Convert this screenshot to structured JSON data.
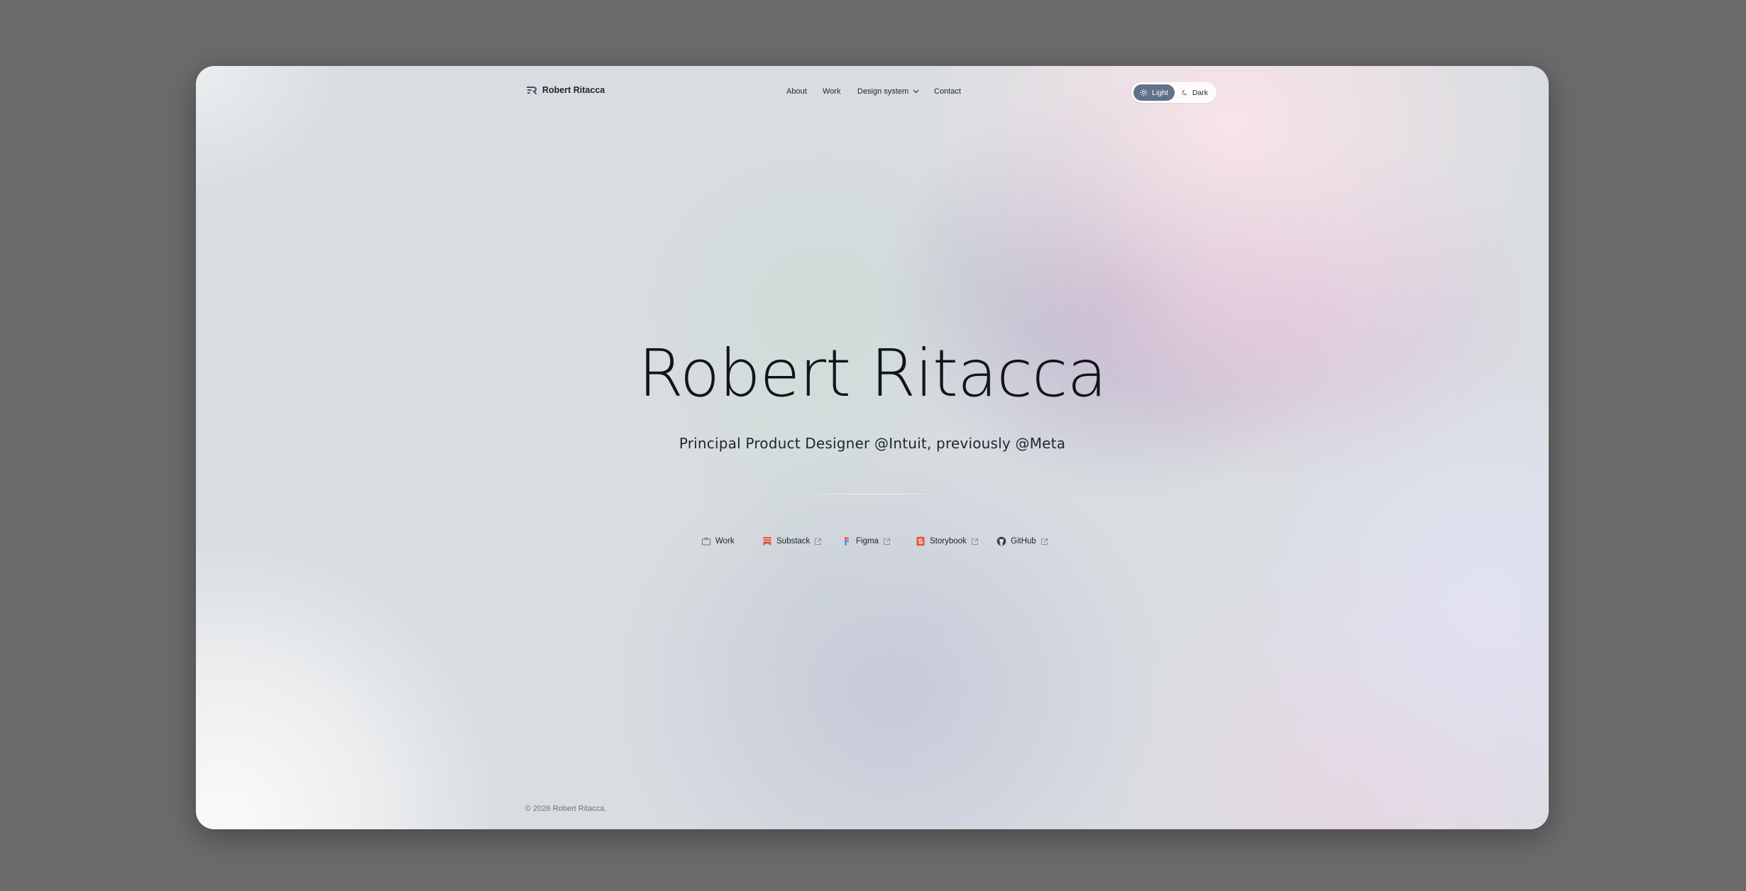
{
  "nav": {
    "brand": "Robert Ritacca",
    "links": [
      {
        "label": "About"
      },
      {
        "label": "Work"
      },
      {
        "label": "Design system"
      },
      {
        "label": "Contact"
      }
    ],
    "theme_toggle": {
      "light_label": "Light",
      "dark_label": "Dark",
      "selected": "Light"
    }
  },
  "hero": {
    "title": "Robert Ritacca",
    "subtitle": "Principal Product Designer @Intuit, previously @Meta"
  },
  "links": [
    {
      "label": "Work",
      "icon": "briefcase-icon",
      "external": false
    },
    {
      "label": "Substack",
      "icon": "substack-icon",
      "external": true
    },
    {
      "label": "Figma",
      "icon": "figma-icon",
      "external": true
    },
    {
      "label": "Storybook",
      "icon": "storybook-icon",
      "external": true
    },
    {
      "label": "GitHub",
      "icon": "github-icon",
      "external": true
    }
  ],
  "footer": {
    "copyright": "© 2026 Robert Ritacca."
  },
  "colors": {
    "toggle_active": "#607188",
    "substack": "#e8553f",
    "storybook": "#e8553f",
    "text": "#1d2430"
  }
}
